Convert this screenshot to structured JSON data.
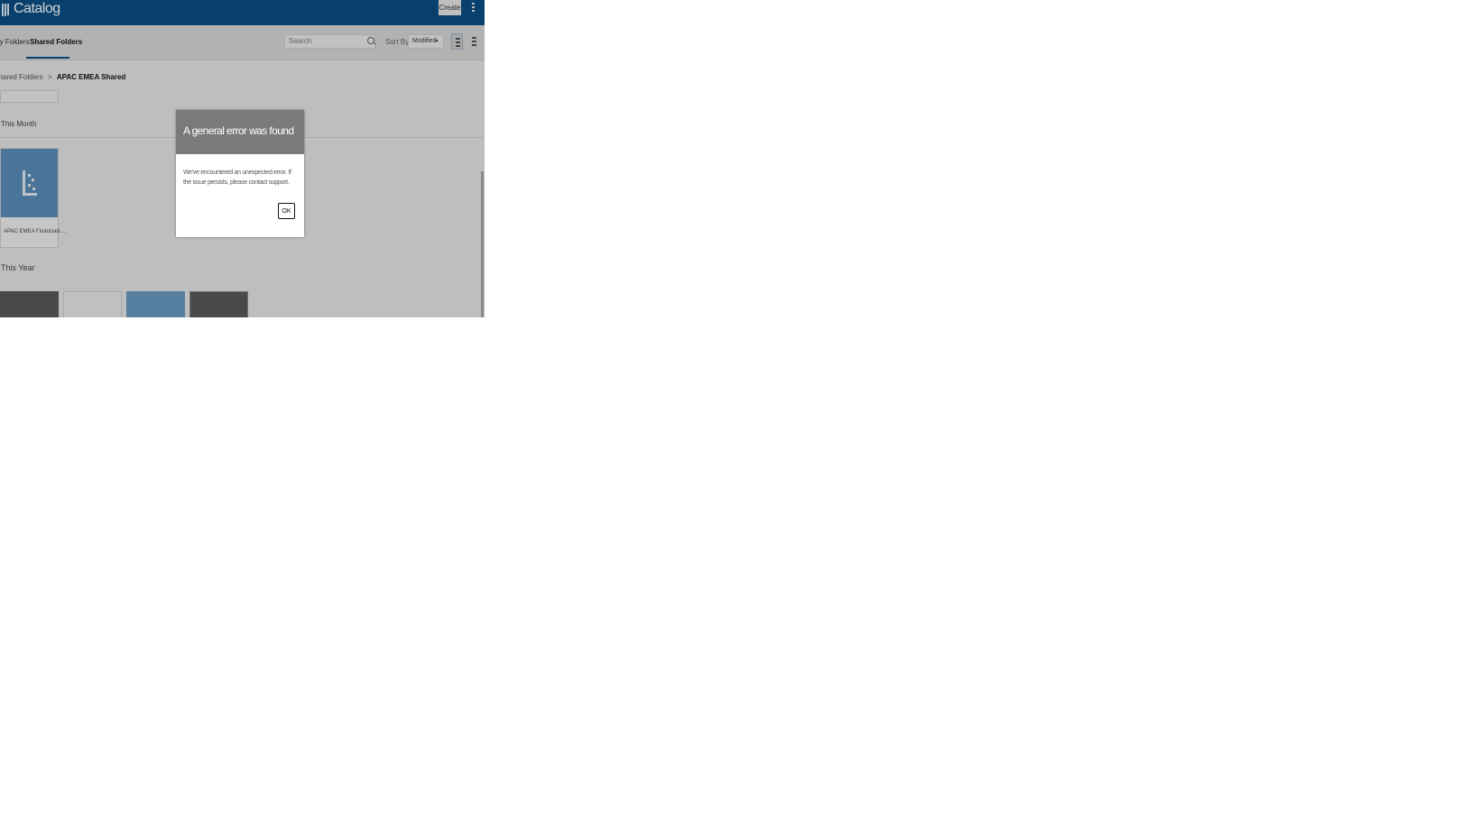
{
  "header": {
    "title": "Catalog",
    "create_label": "Create",
    "icon": "catalog-book-icon",
    "menu_icon": "kebab-menu-icon"
  },
  "tabs": [
    {
      "label": "My Folders"
    },
    {
      "label": "Shared Folders",
      "active": true
    }
  ],
  "toolbar": {
    "search_placeholder": "Search",
    "sort_label": "Sort By",
    "sort_value": "Modified"
  },
  "breadcrumb": {
    "parent": "Shared Folders",
    "separator": ">",
    "current": "APAC EMEA Shared"
  },
  "sections": {
    "this_month": "This Month",
    "this_year": "This Year"
  },
  "cards": [
    {
      "label": "APAC EMEA Financials ..."
    }
  ],
  "dialog": {
    "title": "A general error was found",
    "message": "We've encountered an unexpected error. If the issue persists, please contact support.",
    "ok_label": "OK"
  },
  "colors": {
    "topbar": "#0a4f86",
    "dialog_header": "#7a7a7a",
    "card_thumb": "#5b8fba"
  }
}
